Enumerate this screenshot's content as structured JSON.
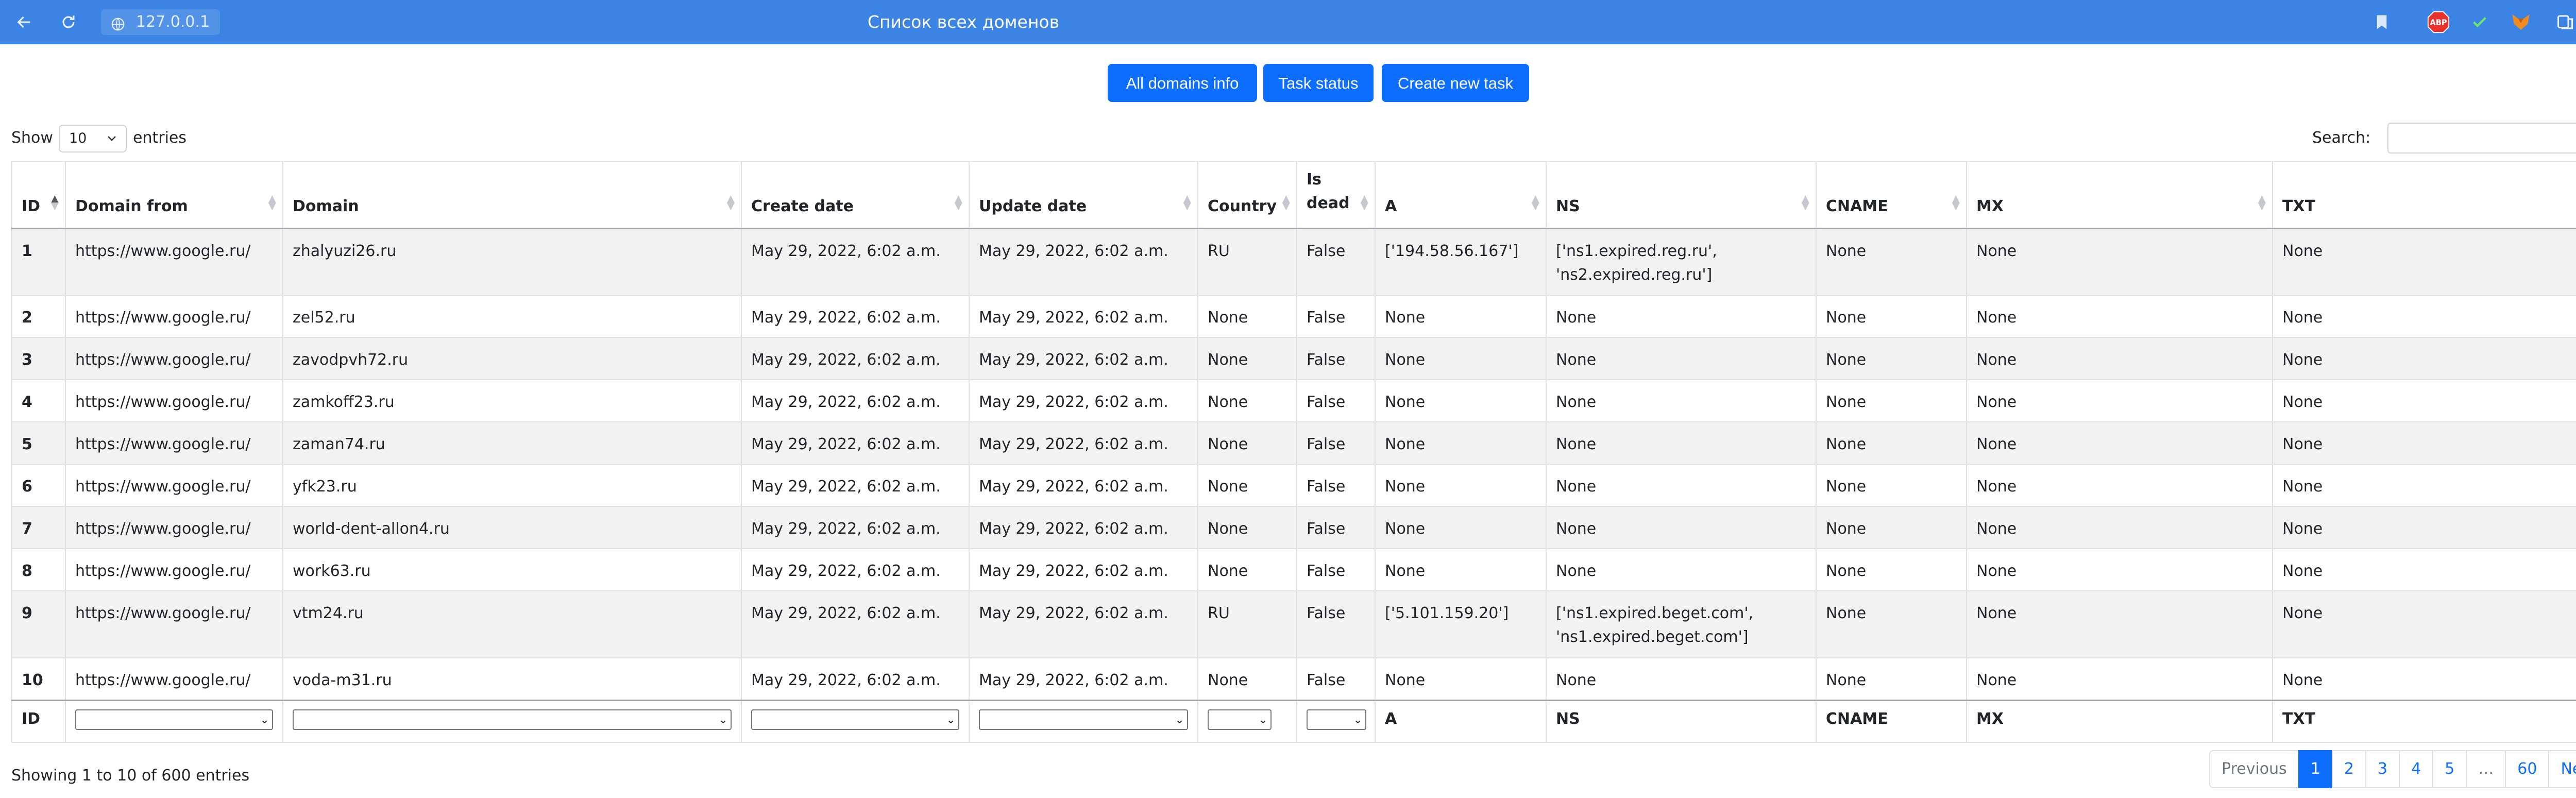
{
  "browser": {
    "url": "127.0.0.1",
    "title": "Список всех доменов"
  },
  "toolbar": {
    "all_domains_info": "All domains info",
    "task_status": "Task status",
    "create_new_task": "Create new task"
  },
  "length": {
    "show": "Show",
    "value": "10",
    "entries": "entries"
  },
  "search": {
    "label": "Search:",
    "value": ""
  },
  "table": {
    "columns": [
      "ID",
      "Domain from",
      "Domain",
      "Create date",
      "Update date",
      "Country",
      "Is dead",
      "A",
      "NS",
      "CNAME",
      "MX",
      "TXT"
    ],
    "rows": [
      [
        "1",
        "https://www.google.ru/",
        "zhalyuzi26.ru",
        "May 29, 2022, 6:02 a.m.",
        "May 29, 2022, 6:02 a.m.",
        "RU",
        "False",
        "['194.58.56.167']",
        "['ns1.expired.reg.ru', 'ns2.expired.reg.ru']",
        "None",
        "None",
        "None"
      ],
      [
        "2",
        "https://www.google.ru/",
        "zel52.ru",
        "May 29, 2022, 6:02 a.m.",
        "May 29, 2022, 6:02 a.m.",
        "None",
        "False",
        "None",
        "None",
        "None",
        "None",
        "None"
      ],
      [
        "3",
        "https://www.google.ru/",
        "zavodpvh72.ru",
        "May 29, 2022, 6:02 a.m.",
        "May 29, 2022, 6:02 a.m.",
        "None",
        "False",
        "None",
        "None",
        "None",
        "None",
        "None"
      ],
      [
        "4",
        "https://www.google.ru/",
        "zamkoff23.ru",
        "May 29, 2022, 6:02 a.m.",
        "May 29, 2022, 6:02 a.m.",
        "None",
        "False",
        "None",
        "None",
        "None",
        "None",
        "None"
      ],
      [
        "5",
        "https://www.google.ru/",
        "zaman74.ru",
        "May 29, 2022, 6:02 a.m.",
        "May 29, 2022, 6:02 a.m.",
        "None",
        "False",
        "None",
        "None",
        "None",
        "None",
        "None"
      ],
      [
        "6",
        "https://www.google.ru/",
        "yfk23.ru",
        "May 29, 2022, 6:02 a.m.",
        "May 29, 2022, 6:02 a.m.",
        "None",
        "False",
        "None",
        "None",
        "None",
        "None",
        "None"
      ],
      [
        "7",
        "https://www.google.ru/",
        "world-dent-allon4.ru",
        "May 29, 2022, 6:02 a.m.",
        "May 29, 2022, 6:02 a.m.",
        "None",
        "False",
        "None",
        "None",
        "None",
        "None",
        "None"
      ],
      [
        "8",
        "https://www.google.ru/",
        "work63.ru",
        "May 29, 2022, 6:02 a.m.",
        "May 29, 2022, 6:02 a.m.",
        "None",
        "False",
        "None",
        "None",
        "None",
        "None",
        "None"
      ],
      [
        "9",
        "https://www.google.ru/",
        "vtm24.ru",
        "May 29, 2022, 6:02 a.m.",
        "May 29, 2022, 6:02 a.m.",
        "RU",
        "False",
        "['5.101.159.20']",
        "['ns1.expired.beget.com', 'ns1.expired.beget.com']",
        "None",
        "None",
        "None"
      ],
      [
        "10",
        "https://www.google.ru/",
        "voda-m31.ru",
        "May 29, 2022, 6:02 a.m.",
        "May 29, 2022, 6:02 a.m.",
        "None",
        "False",
        "None",
        "None",
        "None",
        "None",
        "None"
      ]
    ],
    "footer": [
      "ID",
      "",
      "",
      "",
      "",
      "",
      "",
      "A",
      "NS",
      "CNAME",
      "MX",
      "TXT"
    ]
  },
  "info": "Showing 1 to 10 of 600 entries",
  "pagination": {
    "previous": "Previous",
    "pages": [
      "1",
      "2",
      "3",
      "4",
      "5",
      "…",
      "60"
    ],
    "next": "Next",
    "active": "1"
  },
  "colors": {
    "browser_bar": "#3c84e4",
    "primary": "#0d6efd",
    "stripe": "#f2f2f2"
  }
}
